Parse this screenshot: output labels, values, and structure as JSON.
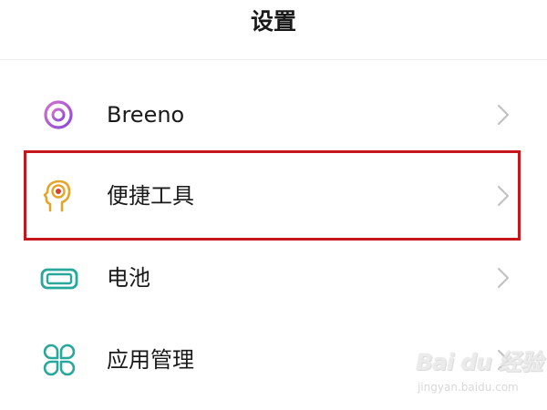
{
  "header": {
    "title": "设置"
  },
  "items": [
    {
      "label": "Breeno",
      "icon": "breeno-ring-icon"
    },
    {
      "label": "便捷工具",
      "icon": "head-target-icon"
    },
    {
      "label": "电池",
      "icon": "battery-icon"
    },
    {
      "label": "应用管理",
      "icon": "app-grid-icon"
    }
  ],
  "colors": {
    "highlight": "#c8161d",
    "breeno_gradient_start": "#d36fd0",
    "breeno_gradient_end": "#8a4bd8",
    "tools_icon": "#e3a52a",
    "tools_target": "#d9402c",
    "battery_icon": "#27a89a",
    "apps_icon": "#27a89a",
    "chevron": "#c2c2c2"
  },
  "watermark": {
    "brand": "Bai du 经验",
    "domain": "jingyan.baidu.com"
  }
}
